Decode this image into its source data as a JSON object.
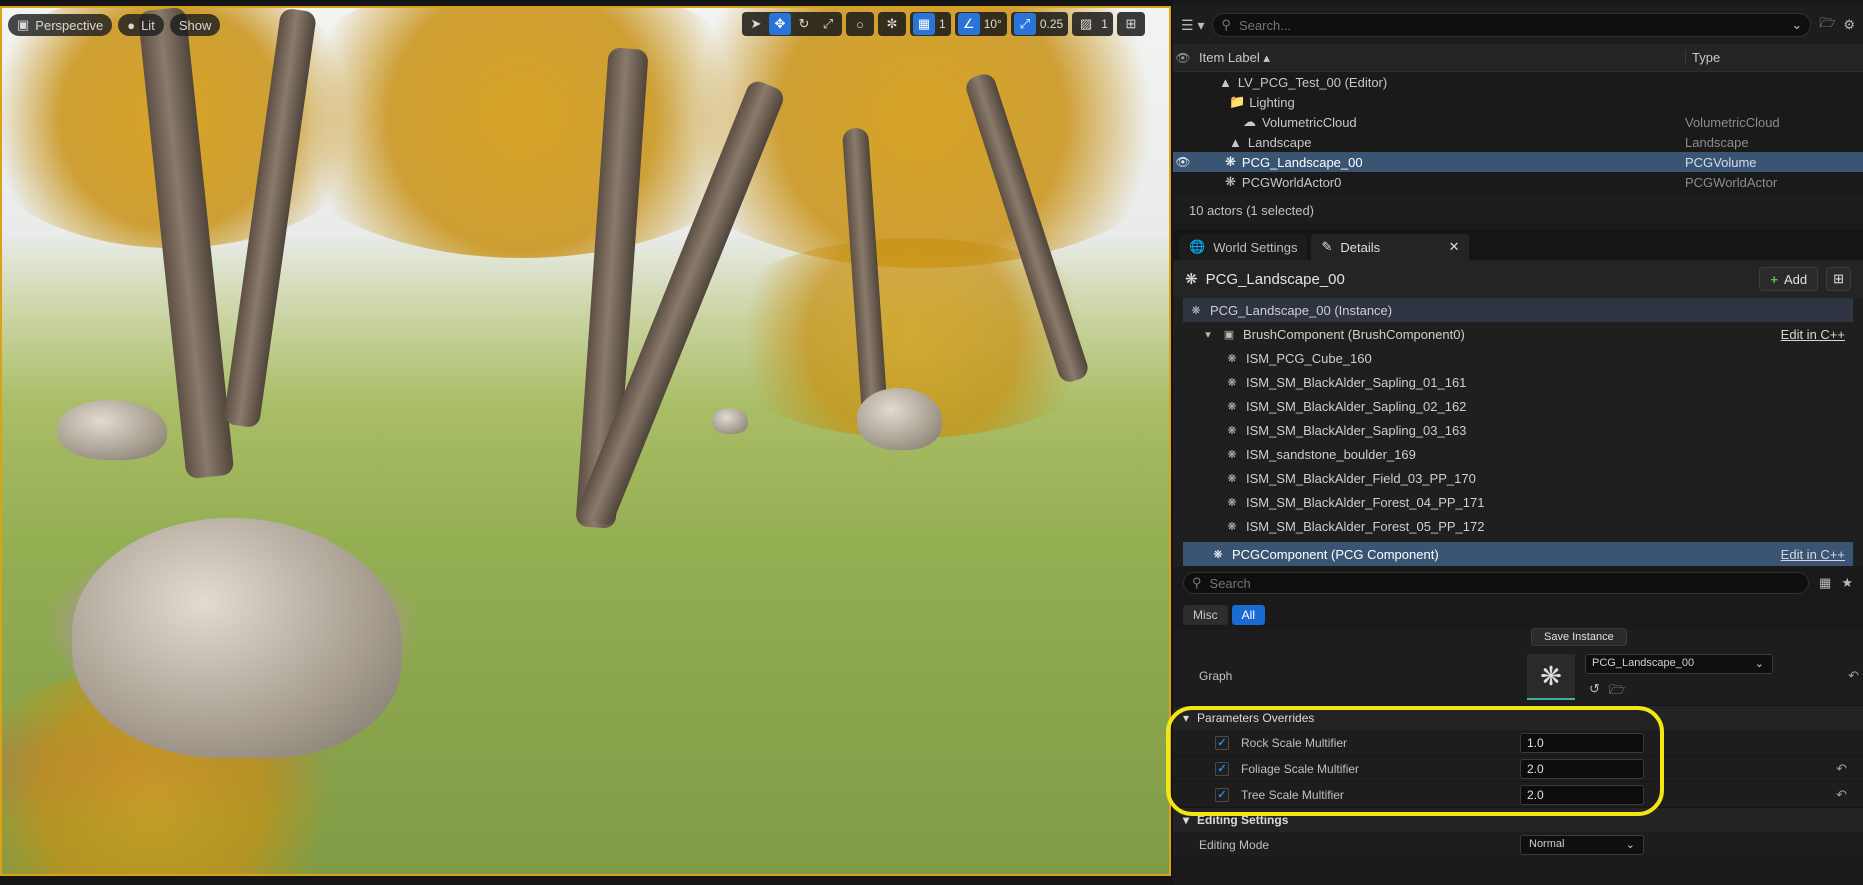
{
  "viewport": {
    "perspective_label": "Perspective",
    "lit_label": "Lit",
    "show_label": "Show",
    "grid_value": "1",
    "angle_value": "10°",
    "scale_value": "0.25",
    "camera_speed": "1"
  },
  "outliner": {
    "search_placeholder": "Search...",
    "col_label": "Item Label",
    "col_type": "Type",
    "rows": [
      {
        "label": "LV_PCG_Test_00 (Editor)",
        "type": ""
      },
      {
        "label": "Lighting",
        "type": ""
      },
      {
        "label": "VolumetricCloud",
        "type": "VolumetricCloud"
      },
      {
        "label": "Landscape",
        "type": "Landscape"
      },
      {
        "label": "PCG_Landscape_00",
        "type": "PCGVolume"
      },
      {
        "label": "PCGWorldActor0",
        "type": "PCGWorldActor"
      }
    ],
    "status": "10 actors (1 selected)"
  },
  "tabs": {
    "world_settings": "World Settings",
    "details": "Details"
  },
  "details": {
    "actor_name": "PCG_Landscape_00",
    "add_label": "Add",
    "instance_label": "PCG_Landscape_00 (Instance)",
    "brush_component": "BrushComponent (BrushComponent0)",
    "edit_cpp": "Edit in C++",
    "components": [
      "ISM_PCG_Cube_160",
      "ISM_SM_BlackAlder_Sapling_01_161",
      "ISM_SM_BlackAlder_Sapling_02_162",
      "ISM_SM_BlackAlder_Sapling_03_163",
      "ISM_sandstone_boulder_169",
      "ISM_SM_BlackAlder_Field_03_PP_170",
      "ISM_SM_BlackAlder_Forest_04_PP_171",
      "ISM_SM_BlackAlder_Forest_05_PP_172"
    ],
    "pcg_component": "PCGComponent (PCG Component)",
    "search_placeholder": "Search",
    "filter_misc": "Misc",
    "filter_all": "All",
    "save_instance": "Save Instance",
    "graph_label": "Graph",
    "graph_value": "PCG_Landscape_00",
    "params_section": "Parameters Overrides",
    "params": [
      {
        "label": "Rock Scale Multifier",
        "value": "1.0",
        "checked": true
      },
      {
        "label": "Foliage Scale Multifier",
        "value": "2.0",
        "checked": true
      },
      {
        "label": "Tree Scale Multifier",
        "value": "2.0",
        "checked": true
      }
    ],
    "editing_section": "Editing Settings",
    "editing_mode_label": "Editing Mode",
    "editing_mode_value": "Normal"
  },
  "colors": {
    "selection_outline": "#d9a21a",
    "annotation": "#f2e613",
    "selected_row": "#3a5474",
    "accent_blue": "#1a6ad2"
  }
}
